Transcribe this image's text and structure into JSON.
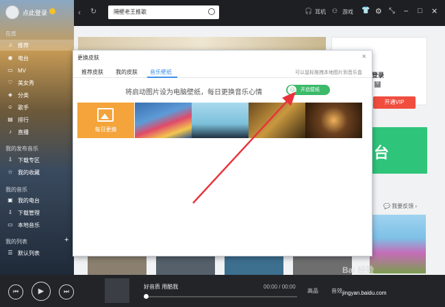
{
  "sidebar": {
    "login_text": "点此登录",
    "section_online": "在库",
    "items_online": [
      "推荐",
      "电台",
      "MV",
      "美女秀",
      "分类",
      "歌手",
      "排行",
      "直播"
    ],
    "section_mine_label": "我的发布音乐",
    "items_mine": [
      "下载专区",
      "我的收藏"
    ],
    "section_mymusic": "我的音乐",
    "items_mymusic": [
      "我的电台",
      "下载管理",
      "本地音乐"
    ],
    "section_lists": "我的列表",
    "items_lists": [
      "默认列表"
    ]
  },
  "topbar": {
    "search_value": "隔壁老王推歌",
    "links": [
      "耳机",
      "游戏"
    ]
  },
  "main": {
    "rightcard_title": "登录",
    "rightcard_badge": "V",
    "rightcard_button": "开通VIP",
    "greencard_text": "台",
    "feedback": "我要反馈"
  },
  "dialog": {
    "title": "更换皮肤",
    "tabs": [
      "推荐皮肤",
      "我的皮肤",
      "音乐壁纸"
    ],
    "active_tab": "音乐壁纸",
    "hint": "可以鼠标拖拽本地图片到音乐盒",
    "description": "将启动图片设为电脑壁纸，每日更换音乐心情",
    "toggle_label": "开启壁纸",
    "daily_label": "每日更换"
  },
  "player": {
    "song_text": "好音质 用酷我",
    "time": "00:00 / 00:00",
    "quality": "高品",
    "sfx": "音效",
    "progress": 0
  },
  "watermark": {
    "text": "Bai 经验",
    "url": "jingyan.baidu.com"
  },
  "colors": {
    "accent_green": "#3cba6a",
    "tab_blue": "#3a8ee6",
    "arrow_red": "#e8333a"
  }
}
